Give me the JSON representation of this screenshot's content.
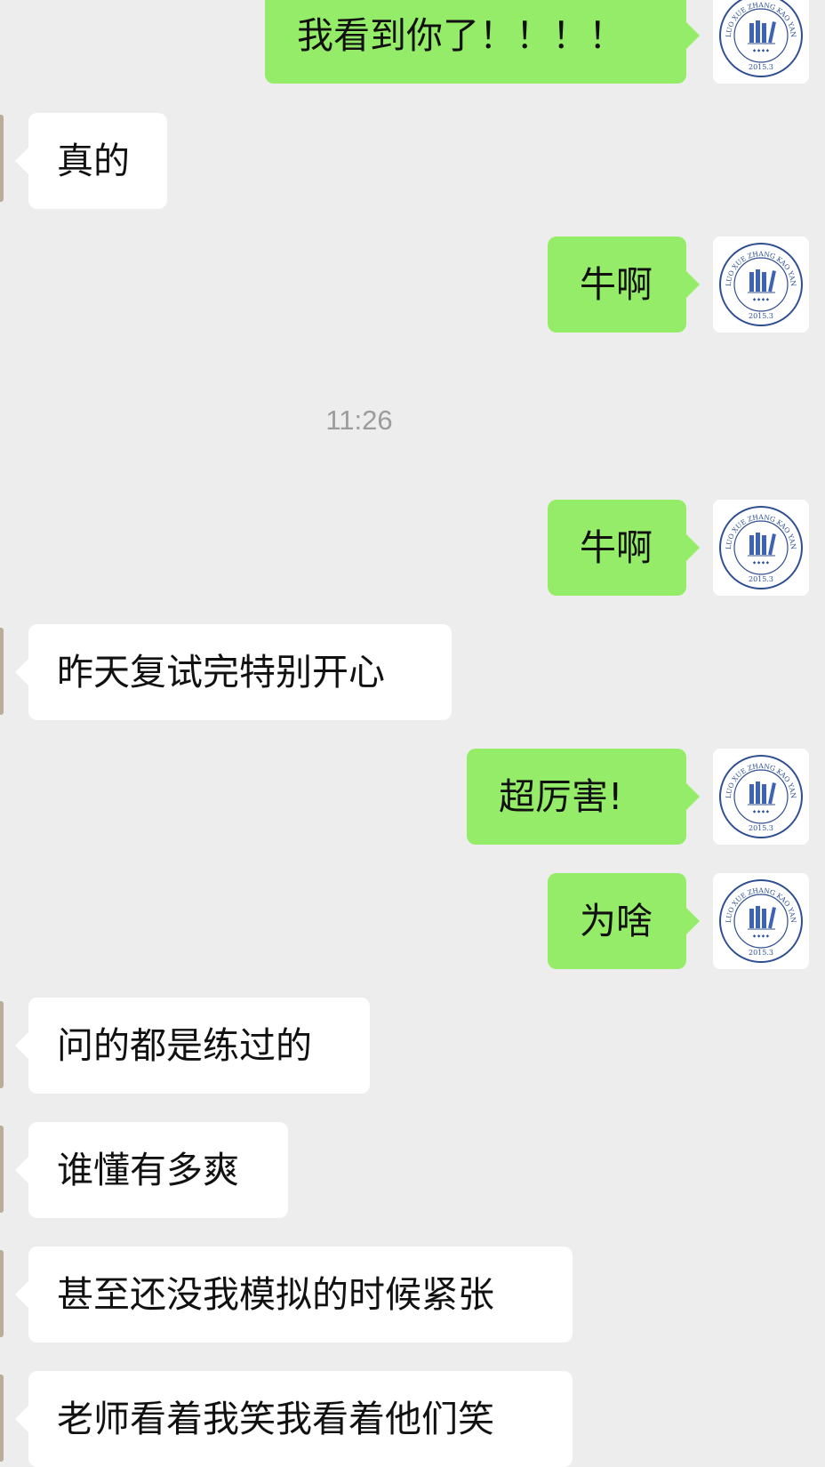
{
  "chat": {
    "timestamp": "11:26",
    "logo": {
      "arc_text_top": "LUO XUE ZHANG KAO YAN",
      "year": "2015.3",
      "colors": {
        "ring": "#2f4f92",
        "books": "#3c63b5"
      }
    },
    "messages": [
      {
        "side": "out",
        "text": "我看到你了！！！！"
      },
      {
        "side": "in",
        "text": "真的"
      },
      {
        "side": "out",
        "text": "牛啊"
      },
      {
        "side": "out",
        "text": "牛啊"
      },
      {
        "side": "in",
        "text": "昨天复试完特别开心"
      },
      {
        "side": "out",
        "text": "超厉害!"
      },
      {
        "side": "out",
        "text": "为啥"
      },
      {
        "side": "in",
        "text": "问的都是练过的"
      },
      {
        "side": "in",
        "text": "谁懂有多爽"
      },
      {
        "side": "in",
        "text": "甚至还没我模拟的时候紧张"
      },
      {
        "side": "in",
        "text": "老师看着我笑我看着他们笑"
      }
    ]
  }
}
